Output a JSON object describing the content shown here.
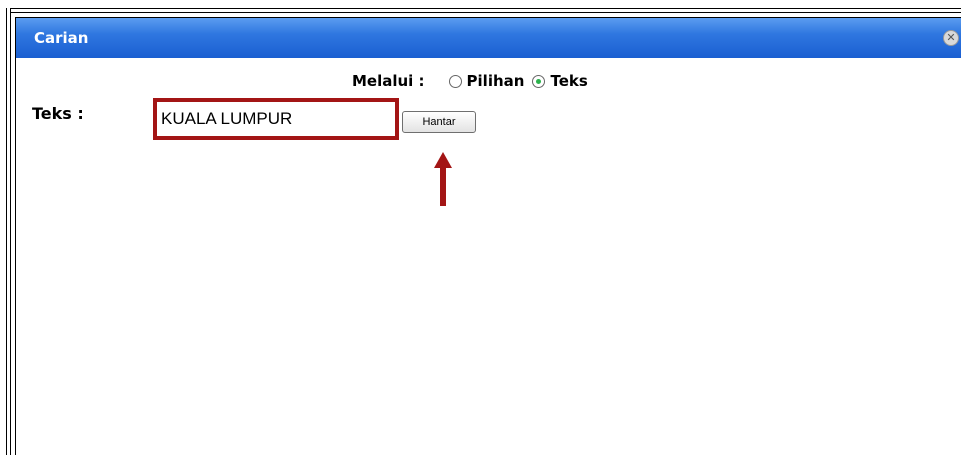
{
  "dialog": {
    "title": "Carian",
    "close_icon": "close-circle-icon"
  },
  "search_mode": {
    "label": "Melalui :",
    "options": [
      {
        "label": "Pilihan",
        "selected": false
      },
      {
        "label": "Teks",
        "selected": true
      }
    ]
  },
  "text_search": {
    "label": "Teks :",
    "value": "KUALA LUMPUR",
    "submit_label": "Hantar"
  },
  "annotation": {
    "highlight_color": "#a31515",
    "arrow_color": "#a31515",
    "arrow_icon": "up-arrow-icon"
  },
  "colors": {
    "titlebar": "#2f77e0",
    "title_text": "#ffffff"
  }
}
